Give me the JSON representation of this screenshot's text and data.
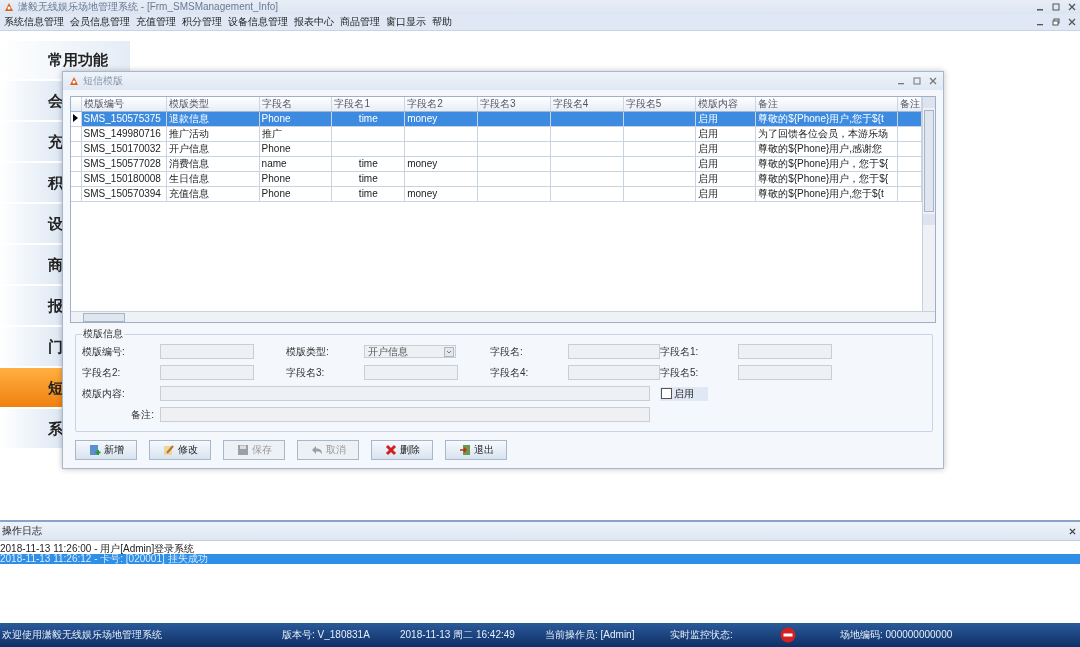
{
  "app_title": "潇毅无线娱乐场地管理系统 - [Frm_SMSManagement_Info]",
  "menu": [
    "系统信息管理",
    "会员信息管理",
    "充值管理",
    "积分管理",
    "设备信息管理",
    "报表中心",
    "商品管理",
    "窗口显示",
    "帮助"
  ],
  "sidebar": {
    "header": "常用功能",
    "items": [
      {
        "label": "会",
        "selected": false
      },
      {
        "label": "充",
        "selected": false
      },
      {
        "label": "积",
        "selected": false
      },
      {
        "label": "设",
        "selected": false
      },
      {
        "label": "商",
        "selected": false
      },
      {
        "label": "报",
        "selected": false
      },
      {
        "label": "门",
        "selected": false
      },
      {
        "label": "短",
        "selected": true
      },
      {
        "label": "系",
        "selected": false
      }
    ]
  },
  "dialog": {
    "title": "短信模版",
    "grid": {
      "columns": [
        "模版编号",
        "模版类型",
        "字段名",
        "字段名1",
        "字段名2",
        "字段名3",
        "字段名4",
        "字段名5",
        "模版内容",
        "备注",
        "备注"
      ],
      "rows": [
        {
          "selected": true,
          "cells": [
            "SMS_150575375",
            "退款信息",
            "Phone",
            "time",
            "money",
            "",
            "",
            "",
            "启用",
            "尊敬的${Phone}用户,您于${t",
            ""
          ]
        },
        {
          "selected": false,
          "cells": [
            "SMS_149980716",
            "推广活动",
            "推广",
            "",
            "",
            "",
            "",
            "",
            "启用",
            "为了回馈各位会员，本游乐场",
            ""
          ]
        },
        {
          "selected": false,
          "cells": [
            "SMS_150170032",
            "开户信息",
            "Phone",
            "",
            "",
            "",
            "",
            "",
            "启用",
            "尊敬的${Phone}用户,感谢您",
            ""
          ]
        },
        {
          "selected": false,
          "cells": [
            "SMS_150577028",
            "消费信息",
            "name",
            "time",
            "money",
            "",
            "",
            "",
            "启用",
            "尊敬的${Phone}用户，您于${",
            ""
          ]
        },
        {
          "selected": false,
          "cells": [
            "SMS_150180008",
            "生日信息",
            "Phone",
            "time",
            "",
            "",
            "",
            "",
            "启用",
            "尊敬的${Phone}用户，您于${",
            ""
          ]
        },
        {
          "selected": false,
          "cells": [
            "SMS_150570394",
            "充值信息",
            "Phone",
            "time",
            "money",
            "",
            "",
            "",
            "启用",
            "尊敬的${Phone}用户,您于${t",
            ""
          ]
        }
      ]
    },
    "form": {
      "title": "模版信息",
      "fields": [
        {
          "kind": "text",
          "label": "模版编号:"
        },
        {
          "kind": "combo",
          "label": "模版类型:",
          "value": "开户信息"
        },
        {
          "kind": "text",
          "label": "字段名:"
        },
        {
          "kind": "text",
          "label": "字段名1:"
        },
        {
          "kind": "text",
          "label": "字段名2:"
        },
        {
          "kind": "text",
          "label": "字段名3:"
        },
        {
          "kind": "text",
          "label": "字段名4:"
        },
        {
          "kind": "text",
          "label": "字段名5:"
        },
        {
          "kind": "wide",
          "label": "模版内容:"
        },
        {
          "kind": "wide",
          "label": "备注:"
        }
      ],
      "checkbox": {
        "label": "启用",
        "checked": false
      }
    },
    "buttons": [
      {
        "kind": "add",
        "label": "新增",
        "disabled": false
      },
      {
        "kind": "edit",
        "label": "修改",
        "disabled": false
      },
      {
        "kind": "save",
        "label": "保存",
        "disabled": true
      },
      {
        "kind": "undo",
        "label": "取消",
        "disabled": true
      },
      {
        "kind": "delete",
        "label": "删除",
        "disabled": false
      },
      {
        "kind": "exit",
        "label": "退出",
        "disabled": false
      }
    ]
  },
  "log": {
    "title": "操作日志",
    "entries": [
      {
        "text": "2018-11-13 11:26:00 - 用户[Admin]登录系统",
        "selected": false
      },
      {
        "text": "2018-11-13 11:26:12 - 卡号: [020001] 挂失成功",
        "selected": true
      }
    ]
  },
  "status_bar": [
    {
      "kind": "text",
      "text": "欢迎使用潇毅无线娱乐场地管理系统"
    },
    {
      "kind": "text",
      "text": "版本号: V_180831A"
    },
    {
      "kind": "text",
      "text": "2018-11-13 周二 16:42:49"
    },
    {
      "kind": "text",
      "text": "当前操作员: [Admin]"
    },
    {
      "kind": "text",
      "text": "实时监控状态:"
    },
    {
      "kind": "stop"
    },
    {
      "kind": "text",
      "text": "场地编码: 000000000000"
    }
  ]
}
